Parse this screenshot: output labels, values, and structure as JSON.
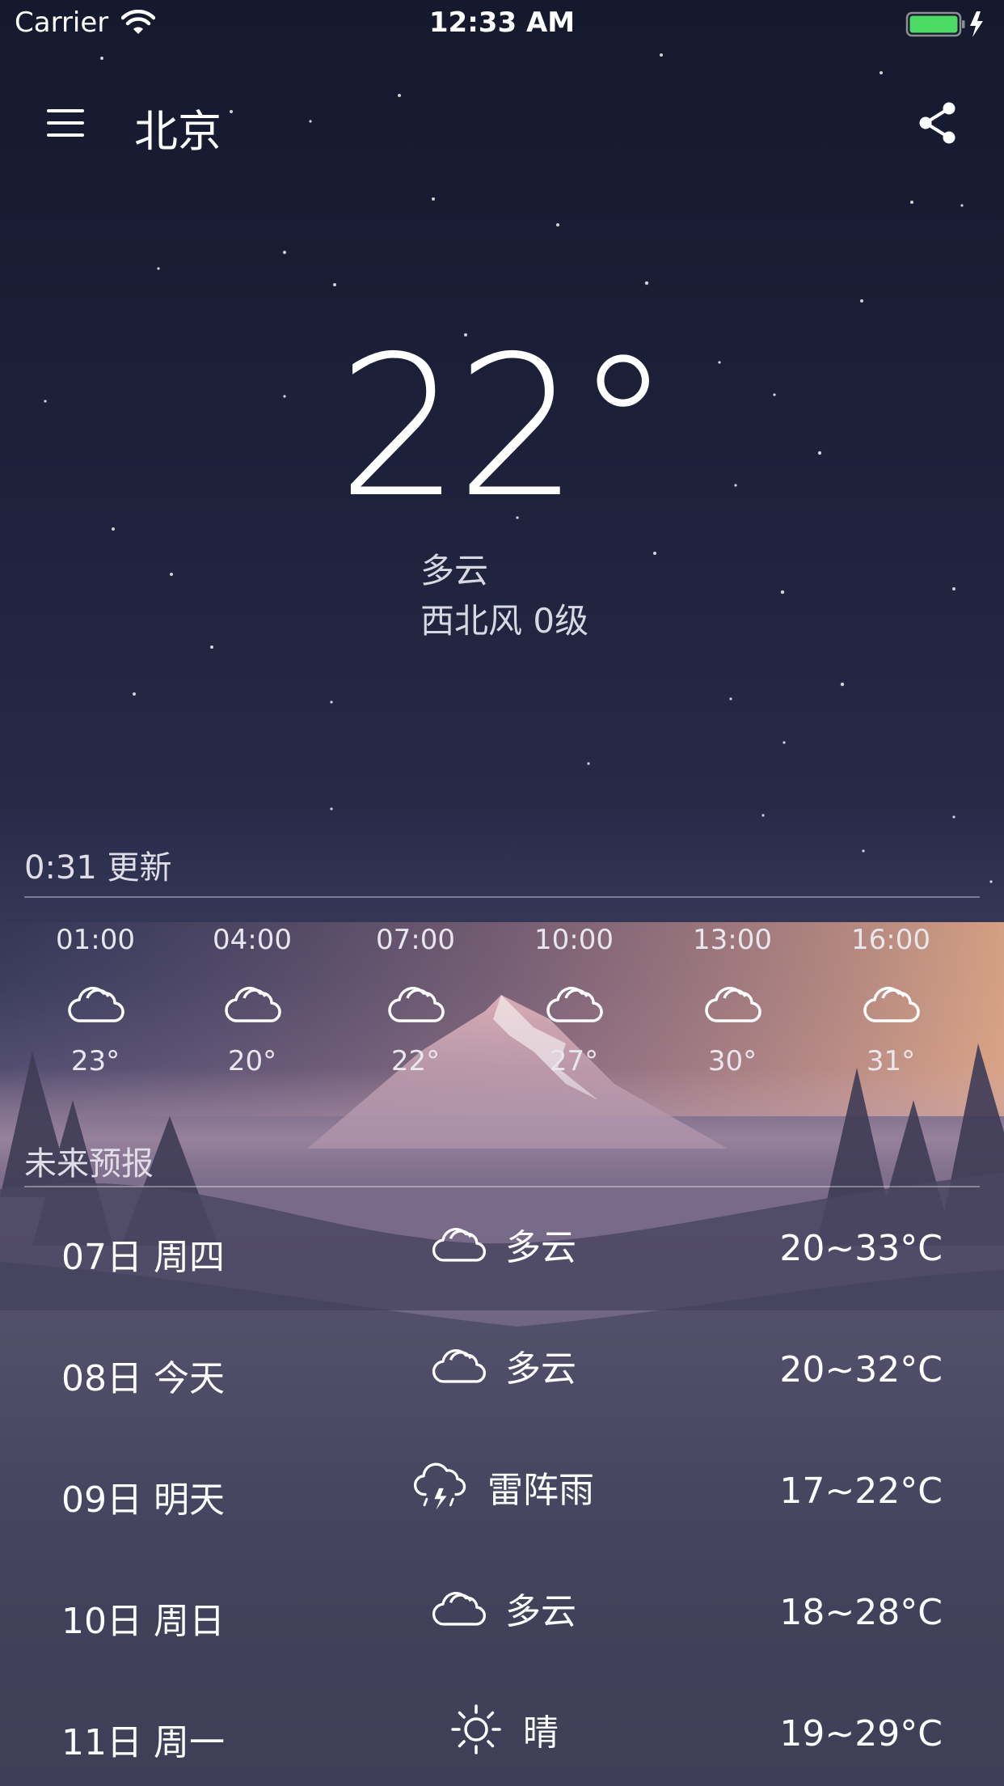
{
  "status_bar": {
    "carrier": "Carrier",
    "time": "12:33 AM",
    "battery_color": "#4cd964"
  },
  "header": {
    "city": "北京"
  },
  "current": {
    "temperature": "22°",
    "condition": "多云",
    "wind": "西北风 0级"
  },
  "hourly": {
    "update_label": "0:31 更新",
    "items": [
      {
        "time": "01:00",
        "icon": "cloud-icon",
        "temp": "23°"
      },
      {
        "time": "04:00",
        "icon": "cloud-icon",
        "temp": "20°"
      },
      {
        "time": "07:00",
        "icon": "cloud-icon",
        "temp": "22°"
      },
      {
        "time": "10:00",
        "icon": "cloud-icon",
        "temp": "27°"
      },
      {
        "time": "13:00",
        "icon": "cloud-icon",
        "temp": "30°"
      },
      {
        "time": "16:00",
        "icon": "cloud-icon",
        "temp": "31°"
      }
    ]
  },
  "forecast": {
    "title": "未来预报",
    "days": [
      {
        "date": "07日 周四",
        "icon": "cloud-icon",
        "condition": "多云",
        "range": "20~33°C"
      },
      {
        "date": "08日 今天",
        "icon": "cloud-icon",
        "condition": "多云",
        "range": "20~32°C"
      },
      {
        "date": "09日 明天",
        "icon": "thunderstorm-icon",
        "condition": "雷阵雨",
        "range": "17~22°C"
      },
      {
        "date": "10日 周日",
        "icon": "cloud-icon",
        "condition": "多云",
        "range": "18~28°C"
      },
      {
        "date": "11日 周一",
        "icon": "sun-icon",
        "condition": "晴",
        "range": "19~29°C"
      }
    ]
  }
}
